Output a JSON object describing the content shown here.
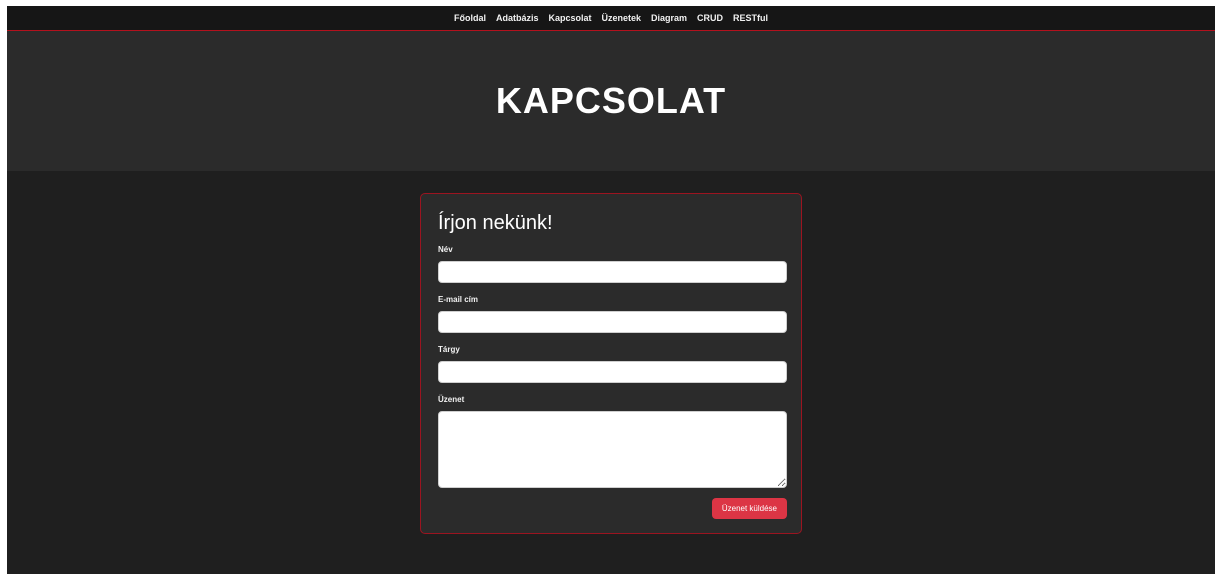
{
  "nav": {
    "items": [
      {
        "label": "Főoldal"
      },
      {
        "label": "Adatbázis"
      },
      {
        "label": "Kapcsolat"
      },
      {
        "label": "Üzenetek"
      },
      {
        "label": "Diagram"
      },
      {
        "label": "CRUD"
      },
      {
        "label": "RESTful"
      }
    ]
  },
  "hero": {
    "title": "KAPCSOLAT"
  },
  "form": {
    "title": "Írjon nekünk!",
    "name_label": "Név",
    "name_value": "",
    "email_label": "E-mail cím",
    "email_value": "",
    "subject_label": "Tárgy",
    "subject_value": "",
    "message_label": "Üzenet",
    "message_value": "",
    "submit_label": "Üzenet küldése"
  },
  "colors": {
    "accent": "#dc3545",
    "border_red": "#9b1420",
    "page_bg": "#1f1f1f",
    "hero_bg": "#2b2b2b"
  }
}
